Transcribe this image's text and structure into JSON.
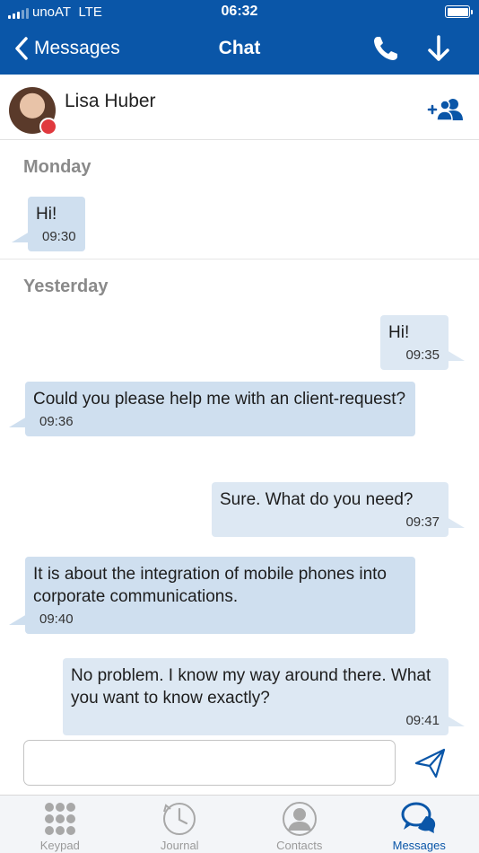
{
  "status_bar": {
    "carrier": "unoAT",
    "network": "LTE",
    "time": "06:32"
  },
  "nav": {
    "back_label": "Messages",
    "title": "Chat",
    "icons": {
      "back": "chevron-left-icon",
      "call": "phone-icon",
      "download": "arrow-down-icon"
    }
  },
  "contact": {
    "name": "Lisa Huber",
    "presence": "busy",
    "presence_color": "#e0393e",
    "add_icon": "add-participant-icon"
  },
  "conversation": {
    "days": [
      {
        "label": "Monday",
        "messages": [
          {
            "direction": "in",
            "text": "Hi!",
            "time": "09:30"
          }
        ]
      },
      {
        "label": "Yesterday",
        "messages": [
          {
            "direction": "out",
            "text": "Hi!",
            "time": "09:35"
          },
          {
            "direction": "in",
            "text": "Could you please help me with an client-request?",
            "time": "09:36"
          },
          {
            "direction": "out",
            "text": "Sure. What do you need?",
            "time": "09:37"
          },
          {
            "direction": "in",
            "text": "It is about the integration of mobile phones into corporate communications.",
            "time": "09:40"
          },
          {
            "direction": "out",
            "text": "No problem. I know my way around there. What you want to know exactly?",
            "time": "09:41"
          }
        ]
      }
    ]
  },
  "composer": {
    "value": "",
    "placeholder": "",
    "send_icon": "send-icon"
  },
  "tabs": [
    {
      "label": "Keypad",
      "icon": "keypad-icon",
      "active": false
    },
    {
      "label": "Journal",
      "icon": "clock-history-icon",
      "active": false
    },
    {
      "label": "Contacts",
      "icon": "person-icon",
      "active": false
    },
    {
      "label": "Messages",
      "icon": "chat-bubbles-icon",
      "active": true
    }
  ],
  "colors": {
    "accent": "#0a56a8",
    "incoming_bubble": "#cfdfef",
    "outgoing_bubble": "#dde8f3",
    "day_label": "#8a8a8a"
  }
}
